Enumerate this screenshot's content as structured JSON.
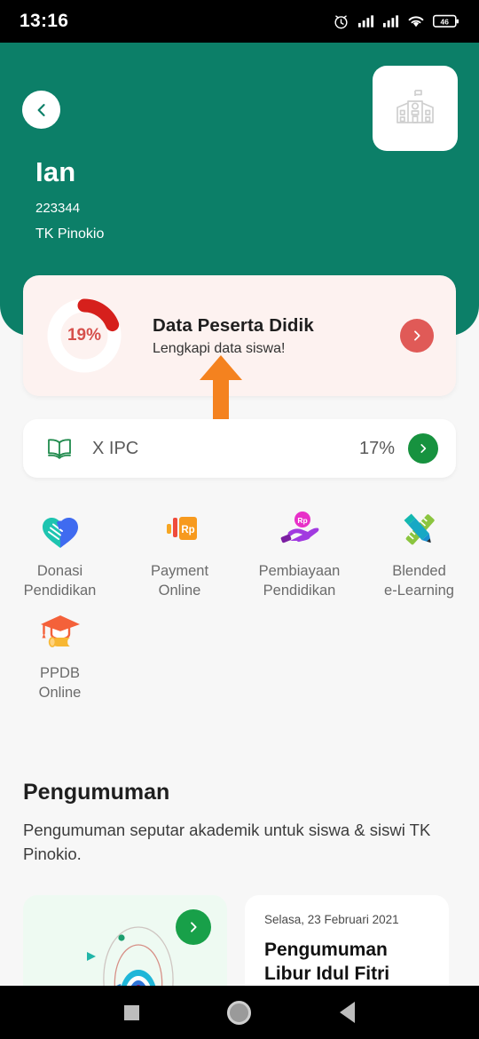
{
  "status_bar": {
    "time": "13:16",
    "icons": [
      "alarm-icon",
      "signal-1-icon",
      "signal-2-icon",
      "wifi-icon",
      "battery-icon"
    ],
    "battery_level": "46"
  },
  "header": {
    "back_icon": "chevron-left-icon",
    "school_icon": "school-building-icon",
    "student_name": "Ian",
    "student_id": "223344",
    "school_name": "TK Pinokio",
    "bg_color": "#0c7f68"
  },
  "data_card": {
    "percent_label": "19%",
    "percent_value": 19,
    "title": "Data Peserta Didik",
    "subtitle": "Lengkapi data siswa!",
    "arrow_icon": "chevron-right-icon",
    "accent_color": "#d6201c",
    "bg_color": "#fdf2f0"
  },
  "annotation": {
    "arrow_icon": "up-arrow-annotation",
    "color": "#f4821f"
  },
  "class_card": {
    "icon": "open-book-icon",
    "label": "X IPC",
    "percent": "17%",
    "arrow_icon": "chevron-right-icon",
    "accent_color": "#17923f"
  },
  "menu": {
    "items": [
      {
        "icon": "donation-hands-heart-icon",
        "label": "Donasi\nPendidikan",
        "line1": "Donasi",
        "line2": "Pendidikan"
      },
      {
        "icon": "payment-rp-card-icon",
        "label": "Payment\nOnline",
        "line1": "Payment",
        "line2": "Online"
      },
      {
        "icon": "hand-rp-coin-icon",
        "label": "Pembiayaan\nPendidikan",
        "line1": "Pembiayaan",
        "line2": "Pendidikan"
      },
      {
        "icon": "pencil-ruler-icon",
        "label": "Blended\ne-Learning",
        "line1": "Blended",
        "line2": "e-Learning"
      },
      {
        "icon": "graduation-cap-diploma-icon",
        "label": "PPDB\nOnline",
        "line1": "PPDB",
        "line2": "Online"
      }
    ]
  },
  "announcement": {
    "title": "Pengumuman",
    "description": "Pengumuman seputar akademik untuk siswa & siswi TK Pinokio.",
    "cards": [
      {
        "type": "illustration",
        "go_icon": "chevron-right-icon"
      },
      {
        "type": "text",
        "date": "Selasa, 23 Februari 2021",
        "headline": "Pengumuman Libur Idul Fitri"
      }
    ]
  },
  "nav_bar": {
    "recents_icon": "square-recents-icon",
    "home_icon": "circle-home-icon",
    "back_icon": "triangle-back-icon"
  }
}
